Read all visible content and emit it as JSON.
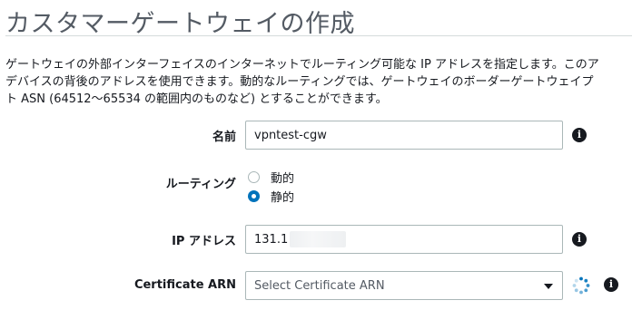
{
  "page": {
    "title": "カスタマーゲートウェイの作成",
    "description_lines": [
      "ゲートウェイの外部インターフェイスのインターネットでルーティング可能な IP アドレスを指定します。このア",
      "デバイスの背後のアドレスを使用できます。動的なルーティングでは、ゲートウェイのボーダーゲートウェイプ",
      "ト ASN (64512〜65534 の範囲内のものなど) とすることができます。"
    ]
  },
  "form": {
    "name": {
      "label": "名前",
      "value": "vpntest-cgw"
    },
    "routing": {
      "label": "ルーティング",
      "options": [
        {
          "label": "動的",
          "selected": false
        },
        {
          "label": "静的",
          "selected": true
        }
      ]
    },
    "ip_address": {
      "label": "IP アドレス",
      "value": "131.1"
    },
    "certificate_arn": {
      "label": "Certificate ARN",
      "placeholder": "Select Certificate ARN"
    }
  },
  "icons": {
    "info": "info-icon",
    "loading": "loading-spinner-icon",
    "dropdown": "chevron-down-icon"
  },
  "colors": {
    "accent": "#0073bb",
    "title": "#545b64",
    "text": "#16191f",
    "border": "#aab7b8"
  }
}
